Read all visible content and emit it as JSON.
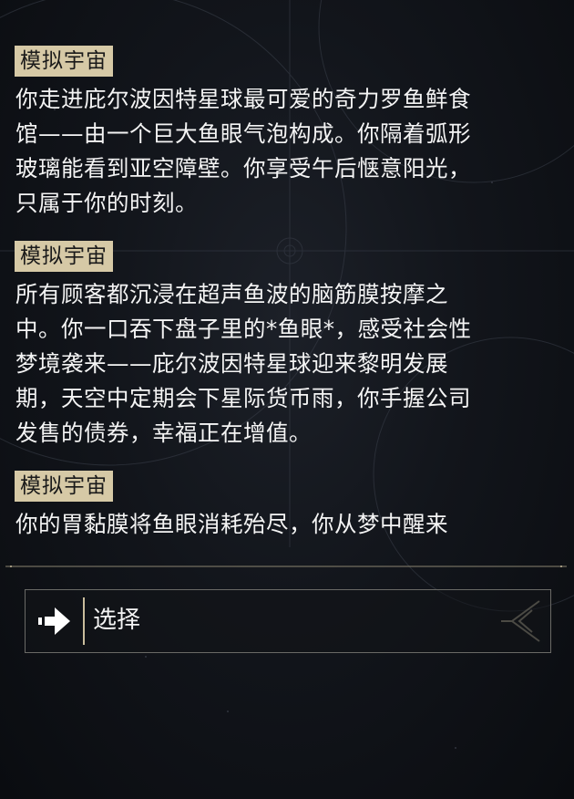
{
  "log": {
    "entries": [
      {
        "tag": "模拟宇宙",
        "lines": [
          "你走进庇尔波因特星球最可爱的奇力罗鱼鲜食",
          "馆——由一个巨大鱼眼气泡构成。你隔着弧形",
          "玻璃能看到亚空障壁。你享受午后惬意阳光，",
          "只属于你的时刻。"
        ]
      },
      {
        "tag": "模拟宇宙",
        "lines": [
          "所有顾客都沉浸在超声鱼波的脑筋膜按摩之",
          "中。你一口吞下盘子里的*鱼眼*，感受社会性",
          "梦境袭来——庇尔波因特星球迎来黎明发展",
          "期，天空中定期会下星际货币雨，你手握公司",
          "发售的债券，幸福正在增值。"
        ]
      },
      {
        "tag": "模拟宇宙",
        "lines": [
          "你的胃黏膜将鱼眼消耗殆尽，你从梦中醒来"
        ]
      }
    ]
  },
  "choice": {
    "label": "选择",
    "arrow_icon": "arrow-right-icon",
    "emblem_icon": "emblem-icon"
  },
  "colors": {
    "tag_bg": "#d6c9a6",
    "text": "#f4f4f4",
    "accent": "#c9bd9c",
    "background": "#12151b"
  }
}
